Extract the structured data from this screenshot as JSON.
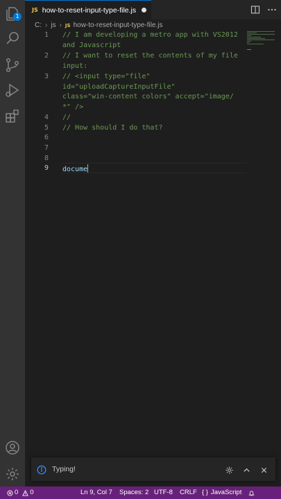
{
  "tab": {
    "filename": "how-to-reset-input-type-file.js",
    "lang_badge": "JS"
  },
  "breadcrumb": {
    "drive": "C:",
    "folder": "js",
    "lang_badge": "JS",
    "file": "how-to-reset-input-type-file.js"
  },
  "activity_bar": {
    "items": [
      "explorer-icon",
      "search-icon",
      "source-control-icon",
      "run-debug-icon",
      "extensions-icon"
    ],
    "explorer_badge": "1",
    "bottom": [
      "account-icon",
      "manage-gear-icon"
    ]
  },
  "editor": {
    "line_numbers": [
      "1",
      "2",
      "3",
      "4",
      "5",
      "6",
      "7",
      "8",
      "9"
    ],
    "rows": [
      "// I am developing a metro app with VS2012",
      "and Javascript",
      "// I want to reset the contents of my file",
      "input:",
      "// <input type=\"file\"",
      "id=\"uploadCaptureInputFile\"",
      "class=\"win-content colors\" accept=\"image/",
      "*\" />",
      "//",
      "// How should I do that?",
      "docume"
    ]
  },
  "notification": {
    "message": "Typing!"
  },
  "status_bar": {
    "errors": "0",
    "warnings": "0",
    "position": "Ln 9, Col 7",
    "spaces": "Spaces: 2",
    "encoding": "UTF-8",
    "eol": "CRLF",
    "language": "JavaScript",
    "language_icon": "{ }"
  },
  "colors": {
    "status_bar": "#68217a",
    "comment": "#6a9955",
    "identifier": "#9cdcfe",
    "accent": "#0078d4",
    "js_badge": "#e8c547"
  }
}
